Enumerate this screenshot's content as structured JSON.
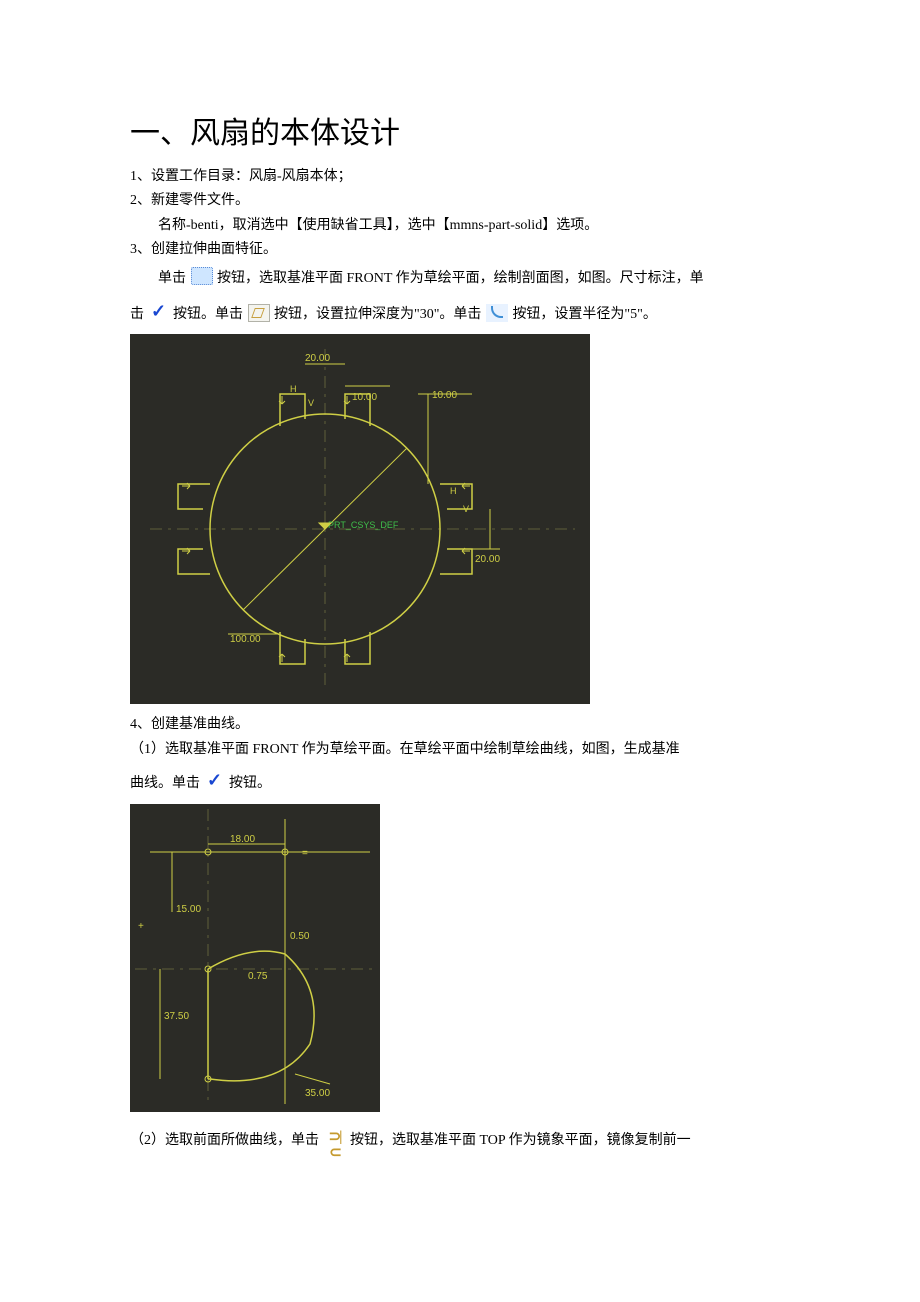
{
  "title": "一、风扇的本体设计",
  "step1": "1、设置工作目录：风扇-风扇本体；",
  "step2": "2、新建零件文件。",
  "step2_detail": "名称-benti，取消选中【使用缺省工具】，选中【mmns-part-solid】选项。",
  "step3": "3、创建拉伸曲面特征。",
  "step3_p1a": "单击",
  "step3_p1b": "按钮，选取基准平面 FRONT 作为草绘平面，绘制剖面图，如图。尺寸标注，单",
  "step3_p2a": "击",
  "step3_p2b": "按钮。单击",
  "step3_p2c": "按钮，设置拉伸深度为\"30\"。单击",
  "step3_p2d": "按钮，设置半径为\"5\"。",
  "step4": "4、创建基准曲线。",
  "step4_1a": "（1）选取基准平面 FRONT 作为草绘平面。在草绘平面中绘制草绘曲线，如图，生成基准",
  "step4_1b_pre": "曲线。单击",
  "step4_1b_post": "按钮。",
  "step4_2a": "（2）选取前面所做曲线，单击",
  "step4_2b": "按钮，选取基准平面 TOP 作为镜象平面，镜像复制前一",
  "cad1": {
    "dims": {
      "d1": "20.00",
      "d2": "10.00",
      "d3": "10.00",
      "d4": "20.00",
      "d5": "100.00"
    },
    "csys": "PRT_CSYS_DEF",
    "constraints": {
      "h": "H",
      "v": "V"
    }
  },
  "cad2": {
    "dims": {
      "d1": "18.00",
      "d2": "15.00",
      "d3": "37.50",
      "d4": "35.00",
      "d5": "0.50",
      "d6": "0.75"
    }
  }
}
